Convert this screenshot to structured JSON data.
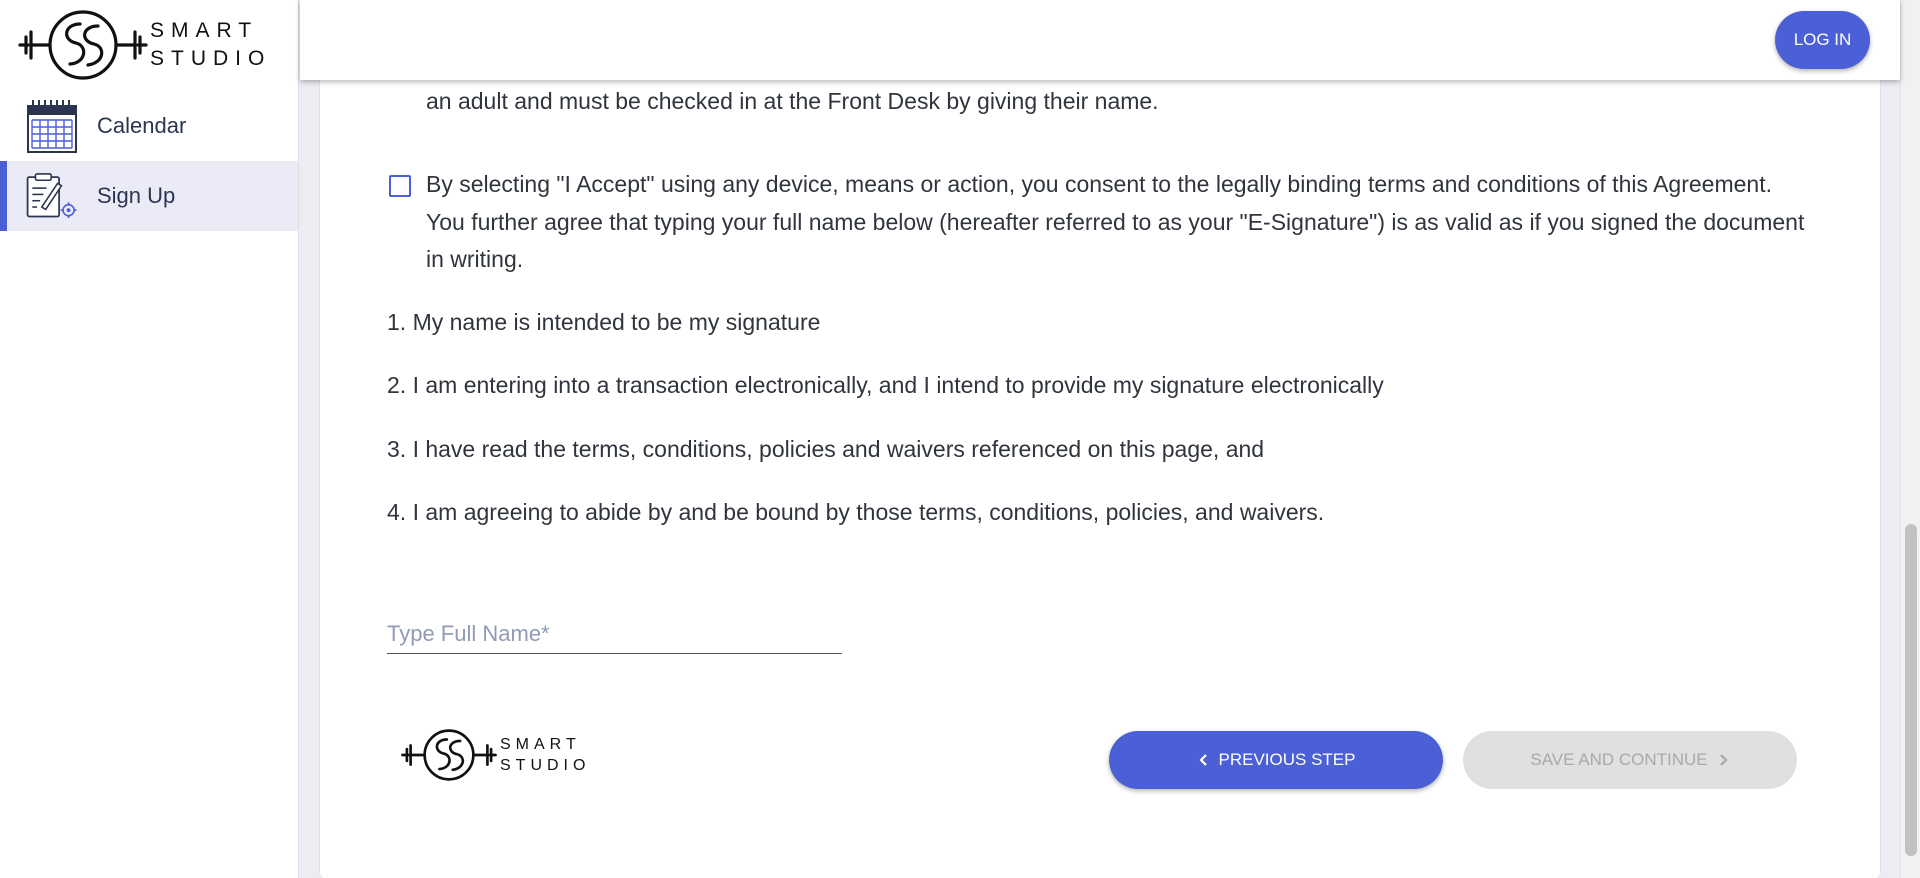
{
  "brand": {
    "line1": "SMART",
    "line2": "STUDIO"
  },
  "sidebar": {
    "items": [
      {
        "label": "Calendar",
        "icon": "calendar-icon",
        "active": false
      },
      {
        "label": "Sign Up",
        "icon": "signup-clipboard-icon",
        "active": true
      }
    ]
  },
  "header": {
    "login_label": "LOG IN"
  },
  "content": {
    "top_partial_line": "an adult and must be checked in at the Front Desk by giving their name.",
    "accept_paragraph": "By selecting \"I Accept\" using any device, means or action, you consent to the legally binding terms and conditions of this Agreement. You further agree that typing your full name below (hereafter referred to as your \"E-Signature\") is as valid as if you signed the document in writing.",
    "list": [
      "1. My name is intended to be my signature",
      "2. I am entering into a transaction electronically, and I intend to provide my signature electronically",
      "3. I have read the terms, conditions, policies and waivers referenced on this page, and",
      "4. I am agreeing to abide by and be bound by those terms, conditions, policies, and waivers."
    ],
    "name_input": {
      "placeholder": "Type Full Name*",
      "value": ""
    }
  },
  "footer": {
    "prev_label": "PREVIOUS STEP",
    "next_label": "SAVE AND CONTINUE"
  },
  "colors": {
    "accent": "#4b5fd6",
    "active_nav_bg": "#ebebf8",
    "disabled_bg": "#e0e0e0",
    "disabled_text": "#a9a9a9"
  }
}
